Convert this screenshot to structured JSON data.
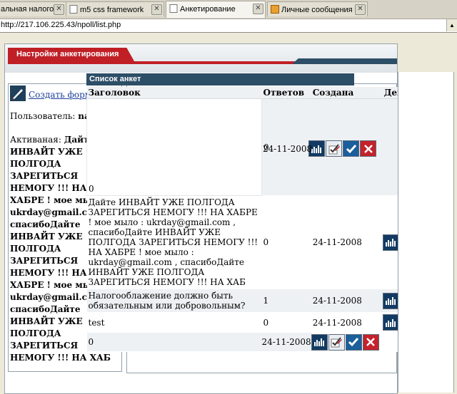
{
  "browser": {
    "tabs": [
      {
        "label": "альная налого...",
        "icon": "page-icon"
      },
      {
        "label": "m5 css framework",
        "icon": "page-icon"
      },
      {
        "label": "Анкетирование",
        "icon": "page-icon"
      },
      {
        "label": "Личные сообщения",
        "icon": "page-icon"
      }
    ],
    "url": "http://217.106.225.43/npoll/list.php"
  },
  "header": {
    "title": "Настройки анкетирования"
  },
  "sidebar": {
    "create_link": "Создать форму",
    "user_label": "Пользователь:",
    "user_name": "nalog",
    "active_label": "Активаная:",
    "active_text": "Дайте ИНВАЙТ УЖЕ ПОЛГОДА ЗАРЕГИТЬСЯ НЕМОГУ !!! НА ХАБРЕ ! мое мыло : ukrday@gmail.com , спасибоДайте ИНВАЙТ УЖЕ ПОЛГОДА ЗАРЕГИТЬСЯ НЕМОГУ !!! НА ХАБРЕ ! мое мыло : ukrday@gmail.com , спасибоДайте ИНВАЙТ УЖЕ ПОЛГОДА ЗАРЕГИТЬСЯ НЕМОГУ !!! НА ХАБ"
  },
  "list": {
    "title": "Список анкет",
    "columns": [
      "Заголовок",
      "Ответов",
      "Создана",
      "Действия"
    ],
    "rows": [
      {
        "title": "",
        "answers": "0",
        "created": "24-11-2008"
      },
      {
        "title": "Дайте ИНВАЙТ УЖЕ ПОЛГОДА ЗАРЕГИТЬСЯ НЕМОГУ !!! НА ХАБРЕ ! мое мыло : ukrday@gmail.com , спасибоДайте ИНВАЙТ УЖЕ ПОЛГОДА ЗАРЕГИТЬСЯ НЕМОГУ !!! НА ХАБРЕ ! мое мыло : ukrday@gmail.com , спасибоДайте ИНВАЙТ УЖЕ ПОЛГОДА ЗАРЕГИТЬСЯ НЕМОГУ !!! НА ХАБ",
        "answers": "0",
        "created": "24-11-2008"
      },
      {
        "title": "Налогооблажение должно быть обязательным или добровольным?",
        "answers": "1",
        "created": "24-11-2008"
      },
      {
        "title": "test",
        "answers": "0",
        "created": "24-11-2008"
      },
      {
        "title": "",
        "answers": "0",
        "created": "24-11-2008"
      }
    ],
    "action_icons": [
      "stats-icon",
      "edit-icon",
      "activate-icon",
      "delete-icon"
    ]
  },
  "colors": {
    "brand_red": "#c01f26",
    "header_blue": "#2d4e67"
  }
}
